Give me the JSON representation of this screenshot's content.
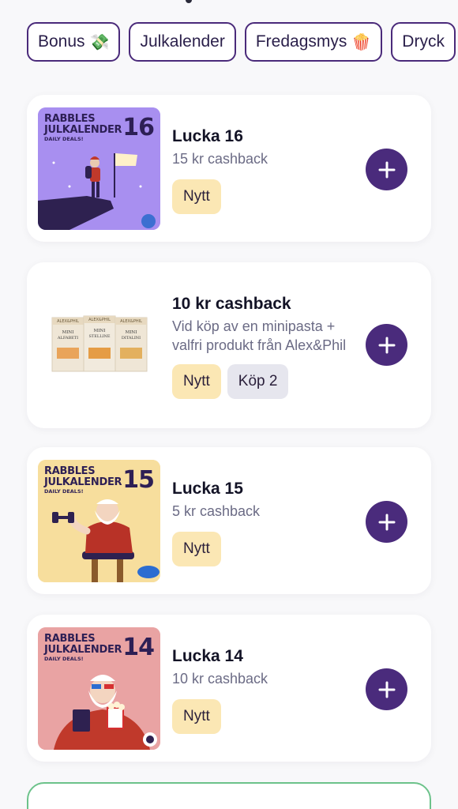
{
  "chips": [
    {
      "label": "Bonus",
      "emoji": "💸"
    },
    {
      "label": "Julkalender",
      "emoji": ""
    },
    {
      "label": "Fredagsmys",
      "emoji": "🍿"
    },
    {
      "label": "Dryck",
      "emoji": ""
    }
  ],
  "cards": [
    {
      "title": "Lucka 16",
      "subtitle": "15 kr cashback",
      "tags": [
        "Nytt"
      ],
      "image": {
        "brand": "RABBLES\nJULKALENDER",
        "tagline": "DAILY DEALS!",
        "number": "16"
      }
    },
    {
      "title": "10 kr cashback",
      "subtitle": "Vid köp av en minipasta + valfri produkt från Alex&Phil",
      "tags": [
        "Nytt",
        "Köp 2"
      ],
      "image": {
        "brand": "ALEX&PHIL",
        "products": [
          "MINI ALFABETI",
          "MINI STELLINE",
          "MINI DITALINI"
        ]
      }
    },
    {
      "title": "Lucka 15",
      "subtitle": "5 kr cashback",
      "tags": [
        "Nytt"
      ],
      "image": {
        "brand": "RABBLES\nJULKALENDER",
        "tagline": "DAILY DEALS!",
        "number": "15"
      }
    },
    {
      "title": "Lucka 14",
      "subtitle": "10 kr cashback",
      "tags": [
        "Nytt"
      ],
      "image": {
        "brand": "RABBLES\nJULKALENDER",
        "tagline": "DAILY DEALS!",
        "number": "14"
      }
    }
  ],
  "colors": {
    "accent": "#4a2b7c",
    "tag_new": "#fbe7b4",
    "tag_buy": "#e6e6ee",
    "bottom_card_border": "#6cc28a"
  },
  "icons": {
    "add": "plus-icon"
  }
}
